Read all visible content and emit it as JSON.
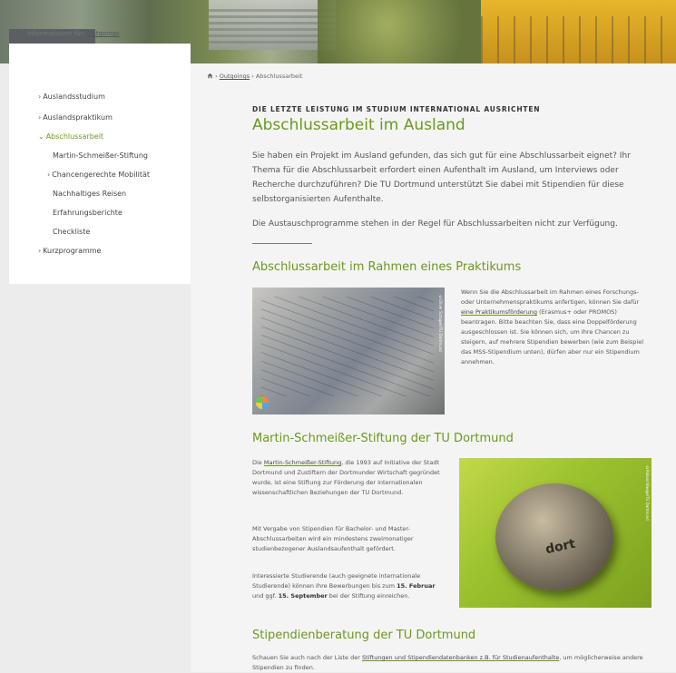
{
  "sidebar": {
    "intro_prefix": "Informationen für:",
    "intro_link": "Outgoings",
    "items": [
      {
        "label": "Auslandsstudium",
        "arrow": "›"
      },
      {
        "label": "Auslandspraktikum",
        "arrow": "›"
      },
      {
        "label": "Abschlussarbeit",
        "arrow": "⌄"
      },
      {
        "label": "Martin-Schmeißer-Stiftung",
        "arrow": ""
      },
      {
        "label": "Chancengerechte Mobilität",
        "arrow": "›"
      },
      {
        "label": "Nachhaltiges Reisen",
        "arrow": ""
      },
      {
        "label": "Erfahrungsberichte",
        "arrow": ""
      },
      {
        "label": "Checkliste",
        "arrow": ""
      },
      {
        "label": "Kurzprogramme",
        "arrow": "›"
      }
    ]
  },
  "breadcrumb": {
    "sep": "›",
    "items": [
      "Outgoings",
      "Abschlussarbeit"
    ]
  },
  "page": {
    "kicker": "DIE LETZTE LEISTUNG IM STUDIUM INTERNATIONAL AUSRICHTEN",
    "title": "Abschlussarbeit im Ausland",
    "intro": "Sie haben ein Projekt im Ausland gefunden, das sich gut für eine Abschlussarbeit eignet? Ihr Thema für die Abschlussarbeit erfordert einen Aufenthalt im Ausland, um Interviews oder Recherche durchzuführen? Die TU Dortmund unterstützt Sie dabei mit Stipendien für diese selbstorganisierten Aufenthalte.",
    "intro2": "Die Austauschprogramme stehen in der Regel für Abschlussarbeiten nicht zur Verfügung."
  },
  "section1": {
    "title": "Abschlussarbeit im Rahmen eines Praktikums",
    "text_a": "Wenn Sie die Abschlussarbeit im Rahmen eines Forschungs- oder Unternehmenspraktikums anfertigen, können Sie dafür ",
    "link": "eine Praktikumsförderung",
    "text_b": " (Erasmus+ oder PROMOS) beantragen. Bitte beachten Sie, dass eine Doppelförderung ausgeschlossen ist. Sie können sich, um Ihre Chancen zu steigern, auf mehrere Stipendien bewerben (wie zum Beispiel das MSS-Stipendium unten), dürfen aber nur ein Stipendium annehmen.",
    "image_credit": "©Oliver Schaper/TU Dortmund"
  },
  "section2": {
    "title": "Martin-Schmeißer-Stiftung der TU Dortmund",
    "p1_prefix": "Die ",
    "p1_link": "Martin-Schmeißer-Stiftung",
    "p1_rest": ", die 1993 auf Initiative der Stadt Dortmund und Zustiftern der Dortmunder Wirtschaft gegründet wurde, ist eine Stiftung zur Förderung der internationalen wissenschaftlichen Beziehungen der TU Dortmund.",
    "p2": "Mit Vergabe von Stipendien für Bachelor- und Master-Abschlussarbeiten wird ein mindestens zweimonatiger studienbezogener Auslandsaufenthalt gefördert.",
    "p3_a": "Interessierte Studierende (auch geeignete internationale Studierende) können Ihre Bewerbungen bis zum ",
    "p3_d1": "15. Februar",
    "p3_b": " und ggf. ",
    "p3_d2": "15. September",
    "p3_c": " bei der Stiftung einreichen.",
    "image_credit": "©Roland Baege/TU Dortmund",
    "coin_text": "dort"
  },
  "section3": {
    "title": "Stipendienberatung der TU Dortmund",
    "text_a": "Schauen Sie auch nach der Liste der ",
    "link": "Stiftungen und Stipendiendatenbanken z.B. für Studienaufenthalte",
    "text_b": ", um möglicherweise andere Stipendien zu finden."
  },
  "colors": {
    "accent": "#6a9a1a",
    "text": "#555555",
    "background": "#f4f4f4"
  }
}
